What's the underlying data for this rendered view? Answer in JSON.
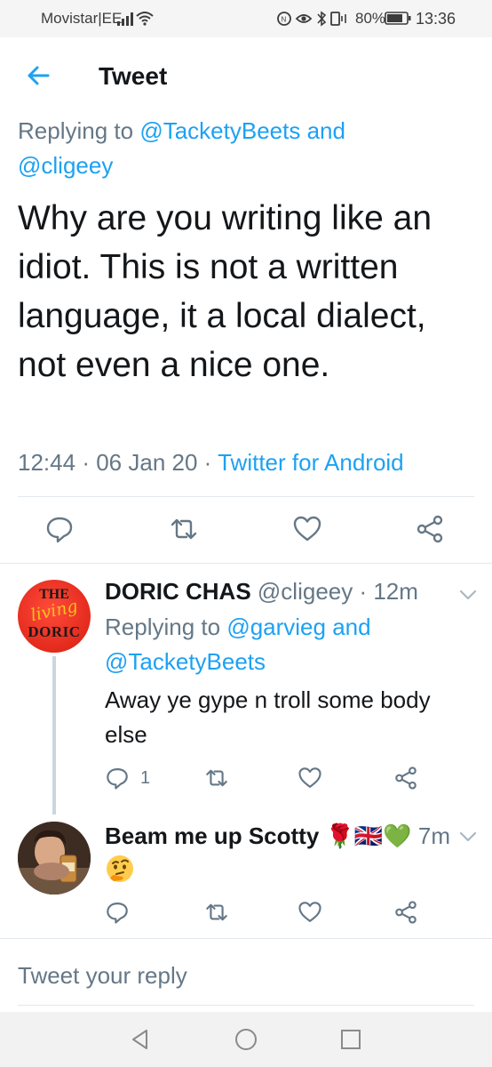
{
  "status_bar": {
    "carrier": "Movistar|EE",
    "battery_percent": "80%",
    "time": "13:36"
  },
  "header": {
    "title": "Tweet"
  },
  "main_tweet": {
    "replying_prefix": "Replying to",
    "replying_user1": "@TacketyBeets",
    "replying_and": "and",
    "replying_user2": "@cligeey",
    "text": "Why are you writing like an idiot. This is not a written language, it a local dialect, not even a nice one.",
    "time": "12:44",
    "date": "06 Jan 20",
    "dot": "·",
    "source": "Twitter for Android"
  },
  "replies": [
    {
      "name": "DORIC CHAS",
      "handle": "@cligeey",
      "age": "· 12m",
      "avatar_text": [
        "THE",
        "living",
        "DORIC"
      ],
      "replying_prefix": "Replying to",
      "replying_user1": "@garvieg",
      "replying_and": "and",
      "replying_user2": "@TacketyBeets",
      "text": "Away  ye gype n troll some body else",
      "reply_count": "1"
    },
    {
      "name": "Beam me up Scotty",
      "name_emojis": "🌹🇬🇧💚",
      "age": "7m",
      "emoji": "thinking-face"
    }
  ],
  "compose": {
    "placeholder": "Tweet your reply"
  },
  "icons": {
    "back": "arrow-left-icon",
    "reply": "comment-icon",
    "retweet": "retweet-icon",
    "like": "heart-icon",
    "share": "share-icon",
    "more": "chevron-down-icon"
  },
  "colors": {
    "accent": "#1da1f2",
    "secondary_text": "#657786",
    "primary_text": "#14171a"
  }
}
